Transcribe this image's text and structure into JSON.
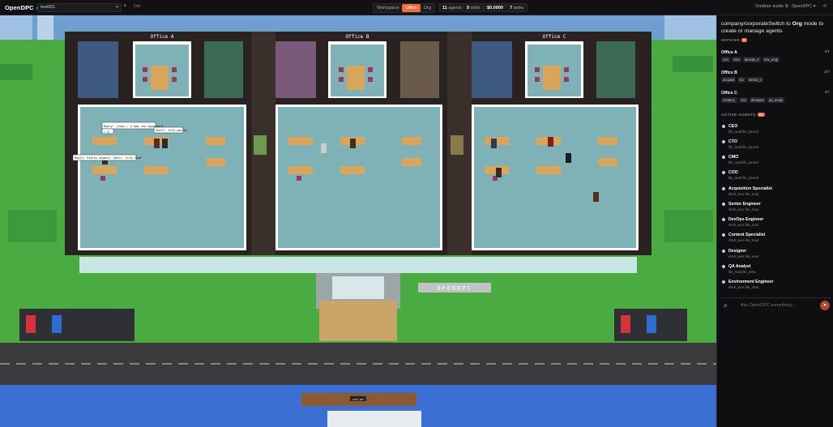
{
  "app": {
    "name": "OpenDPC"
  },
  "header": {
    "project": "test001",
    "delete_label": "Del",
    "modes": [
      "Workspace",
      "Office",
      "Org"
    ],
    "active_mode": "Office",
    "agents_count": "11",
    "agents_label": "agents",
    "skills_count": "9",
    "skills_label": "skills",
    "cost": "$0.0000",
    "tasks_count": "7",
    "tasks_label": "tasks",
    "outdoor_audio": "Outdoor audio",
    "right_menu": "OpenDPC"
  },
  "panel": {
    "title_prefix": "company/corporate",
    "title_switch": "Switch to ",
    "title_org": "Org",
    "title_suffix": " mode to create or manage agents",
    "offices_label": "OFFICES",
    "offices_count": "3",
    "offices": [
      {
        "name": "Office A",
        "count": "4/7",
        "members": [
          "ceo",
          "cmo",
          "devops_e",
          "env_engi"
        ]
      },
      {
        "name": "Office B",
        "count": "3/7",
        "members": [
          "acquisit",
          "cto",
          "senior_e"
        ]
      },
      {
        "name": "Office C",
        "count": "4/7",
        "members": [
          "content_",
          "coo",
          "designer",
          "qa_analy"
        ]
      }
    ],
    "agents_label": "ACTIVE AGENTS",
    "agents_count": "11",
    "agents": [
      {
        "name": "CEO",
        "tools": "file_read  file_search"
      },
      {
        "name": "CTO",
        "tools": "file_read  file_search"
      },
      {
        "name": "CMO",
        "tools": "file_read  file_search"
      },
      {
        "name": "COO",
        "tools": "file_read  file_search"
      },
      {
        "name": "Acquisition Specialist",
        "tools": "shell_exec  file_read"
      },
      {
        "name": "Senior Engineer",
        "tools": "shell_exec  file_read"
      },
      {
        "name": "DevOps Engineer",
        "tools": "shell_exec  file_read"
      },
      {
        "name": "Content Specialist",
        "tools": "shell_exec  file_read"
      },
      {
        "name": "Designer",
        "tools": "shell_exec  file_read"
      },
      {
        "name": "QA Analyst",
        "tools": "file_read  file_write"
      },
      {
        "name": "Environment Engineer",
        "tools": "shell_exec  file_read"
      }
    ],
    "ask_placeholder": "Ask OpenDPC something..."
  },
  "scene": {
    "office_labels": [
      "Office A",
      "Office B",
      "Office C"
    ],
    "sign_text": "OPENDPC",
    "bubbles": [
      "Reply: (tool): $ npm run typecheck",
      "→ $",
      "Shell: file_search",
      "Reply: Status digest: Shell: file_read"
    ],
    "dock_label": "LAST WAY",
    "colors": {
      "accent": "#f06a3b",
      "grass": "#4aab43",
      "floor": "#7fb2b7",
      "wall": "#2a2220",
      "road": "#3b3b3e",
      "water": "#3b6fd4"
    }
  }
}
